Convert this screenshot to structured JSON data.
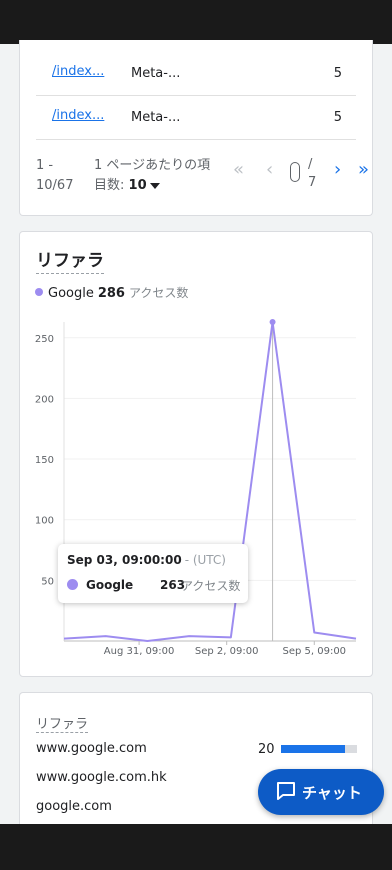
{
  "table": {
    "rows": [
      {
        "path": "/index...",
        "title": "Meta-...",
        "count": "5"
      },
      {
        "path": "/index...",
        "title": "Meta-...",
        "count": "5"
      }
    ],
    "pager": {
      "range_line1": "1 -",
      "range_line2": "10/67",
      "rows_per_page_label": "1 ページあたりの項目数:",
      "rows_per_page_value": "10",
      "first_icon": "double-chevron-left",
      "prev_icon": "chevron-left",
      "next_icon": "chevron-right",
      "last_icon": "double-chevron-right",
      "page_input_value": "",
      "total_pages": "/ 7"
    }
  },
  "referrer_chart": {
    "title": "リファラ",
    "legend": {
      "name": "Google",
      "value": "286",
      "unit": "アクセス数",
      "color": "#9d8cf0"
    },
    "tooltip": {
      "date": "Sep 03, 09:00:00",
      "timezone": "- (UTC)",
      "name": "Google",
      "value": "263",
      "unit": "アクセス数"
    }
  },
  "chart_data": {
    "type": "line",
    "series": [
      {
        "name": "Google",
        "color": "#9d8cf0",
        "values": [
          {
            "x": 0,
            "y": 2
          },
          {
            "x": 1,
            "y": 4
          },
          {
            "x": 2,
            "y": 0
          },
          {
            "x": 3,
            "y": 4
          },
          {
            "x": 4,
            "y": 3
          },
          {
            "x": 5,
            "y": 263
          },
          {
            "x": 6,
            "y": 7
          },
          {
            "x": 7,
            "y": 2
          }
        ]
      }
    ],
    "yticks": [
      50,
      100,
      150,
      200,
      250
    ],
    "ylim": [
      0,
      263
    ],
    "xticks": [
      {
        "x": 1.8,
        "label": "Aug 31, 09:00"
      },
      {
        "x": 3.9,
        "label": "Sep 2, 09:00"
      },
      {
        "x": 6.0,
        "label": "Sep 5, 09:00"
      }
    ],
    "highlight_x": 5
  },
  "referrers": {
    "title": "リファラ",
    "items": [
      {
        "name": "www.google.com",
        "count": "20",
        "bar_fraction": 0.84
      },
      {
        "name": "www.google.com.hk",
        "count": ""
      },
      {
        "name": "google.com",
        "count": ""
      }
    ]
  },
  "chat": {
    "label": "チャット",
    "icon": "chat-bubble"
  }
}
